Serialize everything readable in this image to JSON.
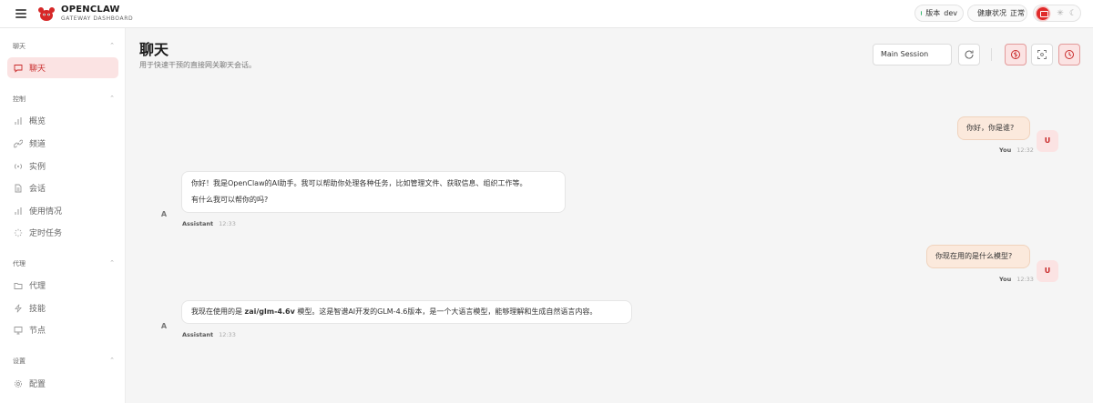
{
  "brand": {
    "title": "OPENCLAW",
    "subtitle": "GATEWAY DASHBOARD"
  },
  "header": {
    "version": {
      "label": "版本",
      "value": "dev"
    },
    "health": {
      "label": "健康状况",
      "value": "正常"
    }
  },
  "sidebar": {
    "groups": [
      {
        "label": "聊天",
        "items": [
          {
            "label": "聊天",
            "icon": "message-icon",
            "active": true
          }
        ]
      },
      {
        "label": "控制",
        "items": [
          {
            "label": "概览",
            "icon": "bar-chart-icon"
          },
          {
            "label": "频道",
            "icon": "link-icon"
          },
          {
            "label": "实例",
            "icon": "radio-icon"
          },
          {
            "label": "会话",
            "icon": "document-icon"
          },
          {
            "label": "使用情况",
            "icon": "bar-chart-icon"
          },
          {
            "label": "定时任务",
            "icon": "loader-icon"
          }
        ]
      },
      {
        "label": "代理",
        "items": [
          {
            "label": "代理",
            "icon": "folder-icon"
          },
          {
            "label": "技能",
            "icon": "zap-icon"
          },
          {
            "label": "节点",
            "icon": "monitor-icon"
          }
        ]
      },
      {
        "label": "设置",
        "items": [
          {
            "label": "配置",
            "icon": "gear-icon"
          }
        ]
      }
    ]
  },
  "main": {
    "title": "聊天",
    "subtitle": "用于快速干预的直接网关聊天会话。",
    "session": "Main Session"
  },
  "messages": [
    {
      "role": "user",
      "avatar": "U",
      "who": "You",
      "time": "12:32",
      "text": "你好，你是谁?"
    },
    {
      "role": "assistant",
      "avatar": "A",
      "who": "Assistant",
      "time": "12:33",
      "line1": "你好！我是OpenClaw的AI助手。我可以帮助你处理各种任务，比如管理文件、获取信息、组织工作等。",
      "line2": "有什么我可以帮你的吗?"
    },
    {
      "role": "user",
      "avatar": "U",
      "who": "You",
      "time": "12:33",
      "text": "你现在用的是什么模型?"
    },
    {
      "role": "assistant",
      "avatar": "A",
      "who": "Assistant",
      "time": "12:33",
      "prefix": "我现在使用的是 ",
      "model": "zai/glm-4.6v",
      "suffix": " 模型。这是智谱AI开发的GLM-4.6版本，是一个大语言模型，能够理解和生成自然语言内容。"
    }
  ],
  "colors": {
    "accent": "#c92b2b",
    "user_bubble": "#fbe9dc",
    "status_ok": "#2fb56a"
  }
}
